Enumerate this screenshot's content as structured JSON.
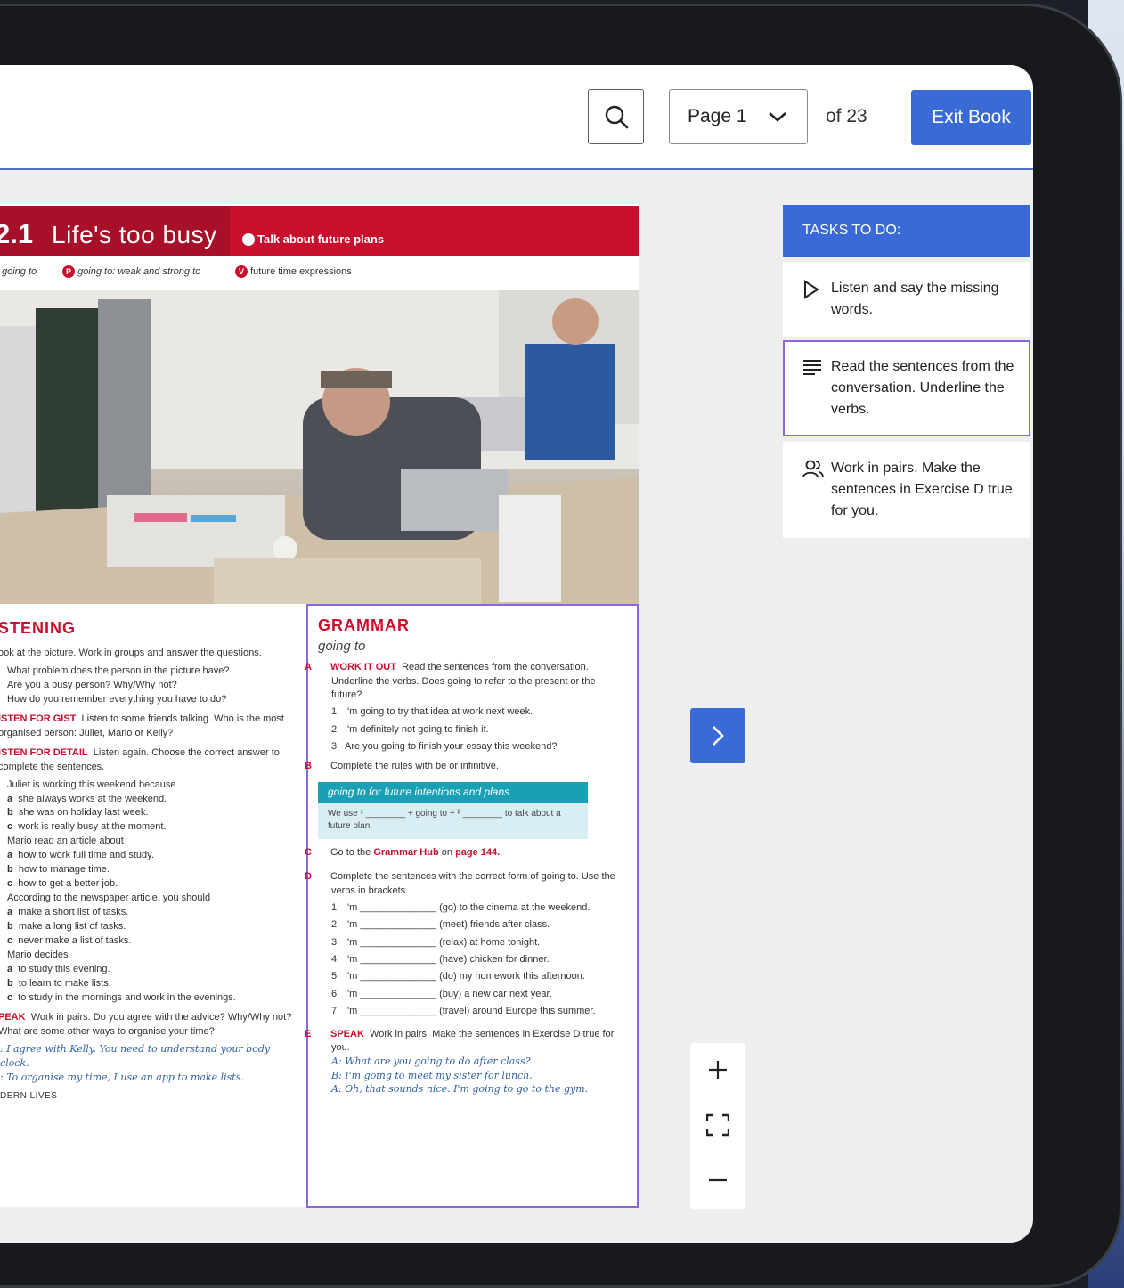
{
  "toolbar": {
    "page_label": "Page 1",
    "of_pages": "of 23",
    "exit_label": "Exit Book"
  },
  "book": {
    "unit_number": "2.1",
    "unit_title": "Life's too busy",
    "goal": "Talk about future plans",
    "sub_items": [
      {
        "badge": "",
        "text": "going to"
      },
      {
        "badge": "P",
        "text": "going to: weak and strong to"
      },
      {
        "badge": "V",
        "text": "future time expressions"
      }
    ],
    "listening": {
      "heading": "STENING",
      "intro": "ook at the picture. Work in groups and answer the questions.",
      "questions": [
        "What problem does the person in the picture have?",
        "Are you a busy person? Why/Why not?",
        "How do you remember everything you have to do?"
      ],
      "gist_label": "ISTEN FOR GIST",
      "gist_text": "Listen to some friends talking. Who is the most organised person: Juliet, Mario or Kelly?",
      "detail_label": "ISTEN FOR DETAIL",
      "detail_text": "Listen again. Choose the correct answer to complete the sentences.",
      "items": [
        {
          "stem": "Juliet is working this weekend because",
          "options": [
            "she always works at the weekend.",
            "she was on holiday last week.",
            "work is really busy at the moment."
          ]
        },
        {
          "stem": "Mario read an article about",
          "options": [
            "how to work full time and study.",
            "how to manage time.",
            "how to get a better job."
          ]
        },
        {
          "stem": "According to the newspaper article, you should",
          "options": [
            "make a short list of tasks.",
            "make a long list of tasks.",
            "never make a list of tasks."
          ]
        },
        {
          "stem": "Mario decides",
          "options": [
            "to study this evening.",
            "to learn to make lists.",
            "to study in the mornings and work in the evenings."
          ]
        }
      ],
      "option_letters": [
        "a",
        "b",
        "c"
      ],
      "speak_label": "PEAK",
      "speak_text": "Work in pairs. Do you agree with the advice? Why/Why not? What are some other ways to organise your time?",
      "examples": [
        ": I agree with Kelly. You need to understand your body clock.",
        ": To organise my time, I use an app to make lists."
      ],
      "footer": "DERN LIVES"
    },
    "grammar": {
      "heading": "GRAMMAR",
      "subheading": "going to",
      "a_letter": "A",
      "a_label": "WORK IT OUT",
      "a_text": "Read the sentences from the conversation. Underline the verbs. Does going to refer to the present or the future?",
      "a_items": [
        "I'm going to try that idea at work next week.",
        "I'm definitely not going to finish it.",
        "Are you going to finish your essay this weekend?"
      ],
      "b_letter": "B",
      "b_text": "Complete the rules with be or infinitive.",
      "rule_head": "going to for future intentions and plans",
      "rule_body": "We use ¹ ________ + going to + ² ________ to talk about a future plan.",
      "c_letter": "C",
      "c_text_1": "Go to the",
      "c_link_1": "Grammar Hub",
      "c_text_2": "on",
      "c_link_2": "page 144.",
      "d_letter": "D",
      "d_text": "Complete the sentences with the correct form of going to. Use the verbs in brackets.",
      "d_items": [
        "I'm ______________ (go) to the cinema at the weekend.",
        "I'm ______________ (meet) friends after class.",
        "I'm ______________ (relax) at home tonight.",
        "I'm ______________ (have) chicken for dinner.",
        "I'm ______________ (do) my homework this afternoon.",
        "I'm ______________ (buy) a new car next year.",
        "I'm ______________ (travel) around Europe this summer."
      ],
      "e_letter": "E",
      "e_label": "SPEAK",
      "e_text": "Work in pairs. Make the sentences in Exercise D true for you.",
      "e_dialogue": [
        "A: What are you going to do after class?",
        "B: I'm going to meet my sister for lunch.",
        "A: Oh, that sounds nice. I'm going to go to the gym."
      ]
    }
  },
  "tasks": {
    "heading": "TASKS TO DO:",
    "items": [
      {
        "icon": "play-icon",
        "text": "Listen and say the missing words."
      },
      {
        "icon": "text-lines-icon",
        "text": "Read the sentences from the conversation. Underline the verbs."
      },
      {
        "icon": "people-icon",
        "text": "Work in pairs. Make the sentences in Exercise D true for you."
      }
    ]
  },
  "colors": {
    "accent": "#3a6ad6",
    "book_red": "#c8102e",
    "highlight": "#8b67db",
    "rule_teal": "#1aa0b4"
  }
}
